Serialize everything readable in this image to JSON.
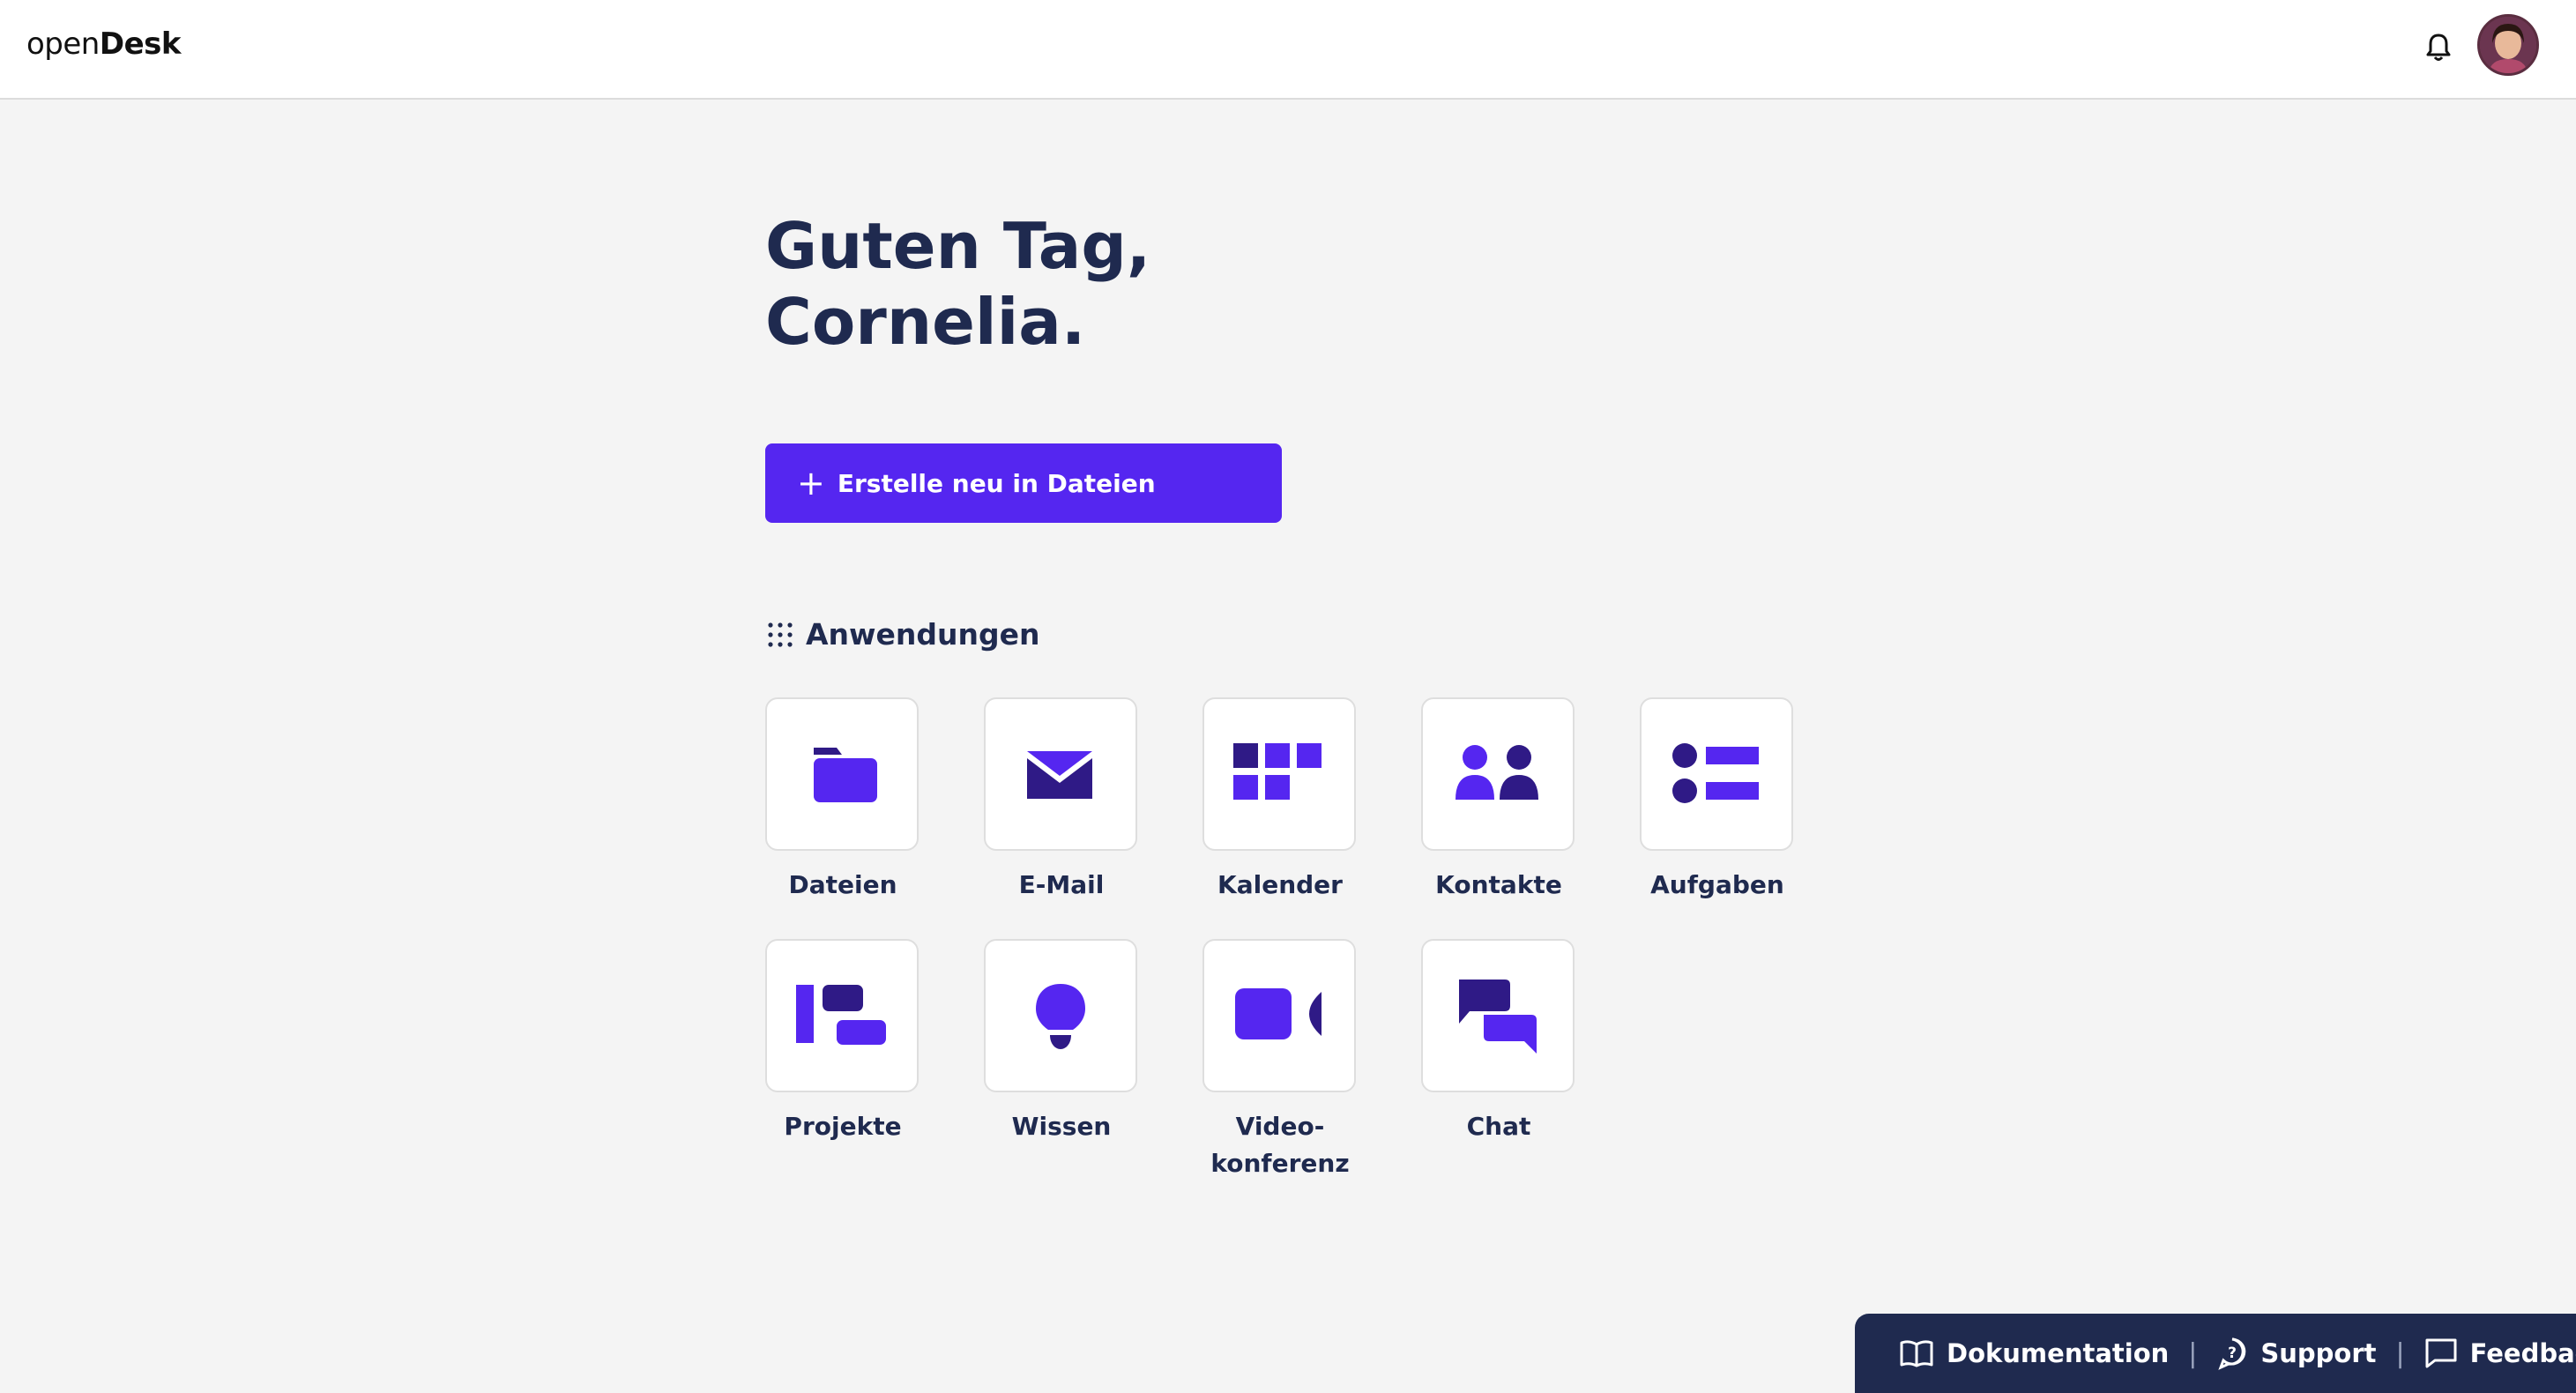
{
  "header": {
    "logo_prefix": "open",
    "logo_suffix": "Desk",
    "notifications_icon": "bell-icon",
    "avatar_icon": "user-avatar"
  },
  "greeting": {
    "line1": "Guten Tag,",
    "line2": "Cornelia."
  },
  "create_button": {
    "icon": "plus-icon",
    "label": "Erstelle neu in Dateien"
  },
  "apps_section": {
    "icon": "grid-icon",
    "title": "Anwendungen",
    "apps": [
      {
        "label": "Dateien",
        "icon": "folder-icon"
      },
      {
        "label": "E-Mail",
        "icon": "mail-icon"
      },
      {
        "label": "Kalender",
        "icon": "calendar-icon"
      },
      {
        "label": "Kontakte",
        "icon": "contacts-icon"
      },
      {
        "label": "Aufgaben",
        "icon": "tasks-icon"
      },
      {
        "label": "Projekte",
        "icon": "projects-icon"
      },
      {
        "label": "Wissen",
        "icon": "lightbulb-icon"
      },
      {
        "label": "Video-\nkonferenz",
        "icon": "video-icon"
      },
      {
        "label": "Chat",
        "icon": "chat-icon"
      }
    ]
  },
  "footer": {
    "links": [
      {
        "label": "Dokumentation",
        "icon": "book-icon"
      },
      {
        "label": "Support",
        "icon": "support-icon"
      },
      {
        "label": "Feedback",
        "icon": "feedback-icon"
      }
    ]
  },
  "colors": {
    "brand": "#5526f0",
    "brand_dark": "#2f1a86",
    "text": "#1f2a4f",
    "background": "#f4f4f4"
  }
}
